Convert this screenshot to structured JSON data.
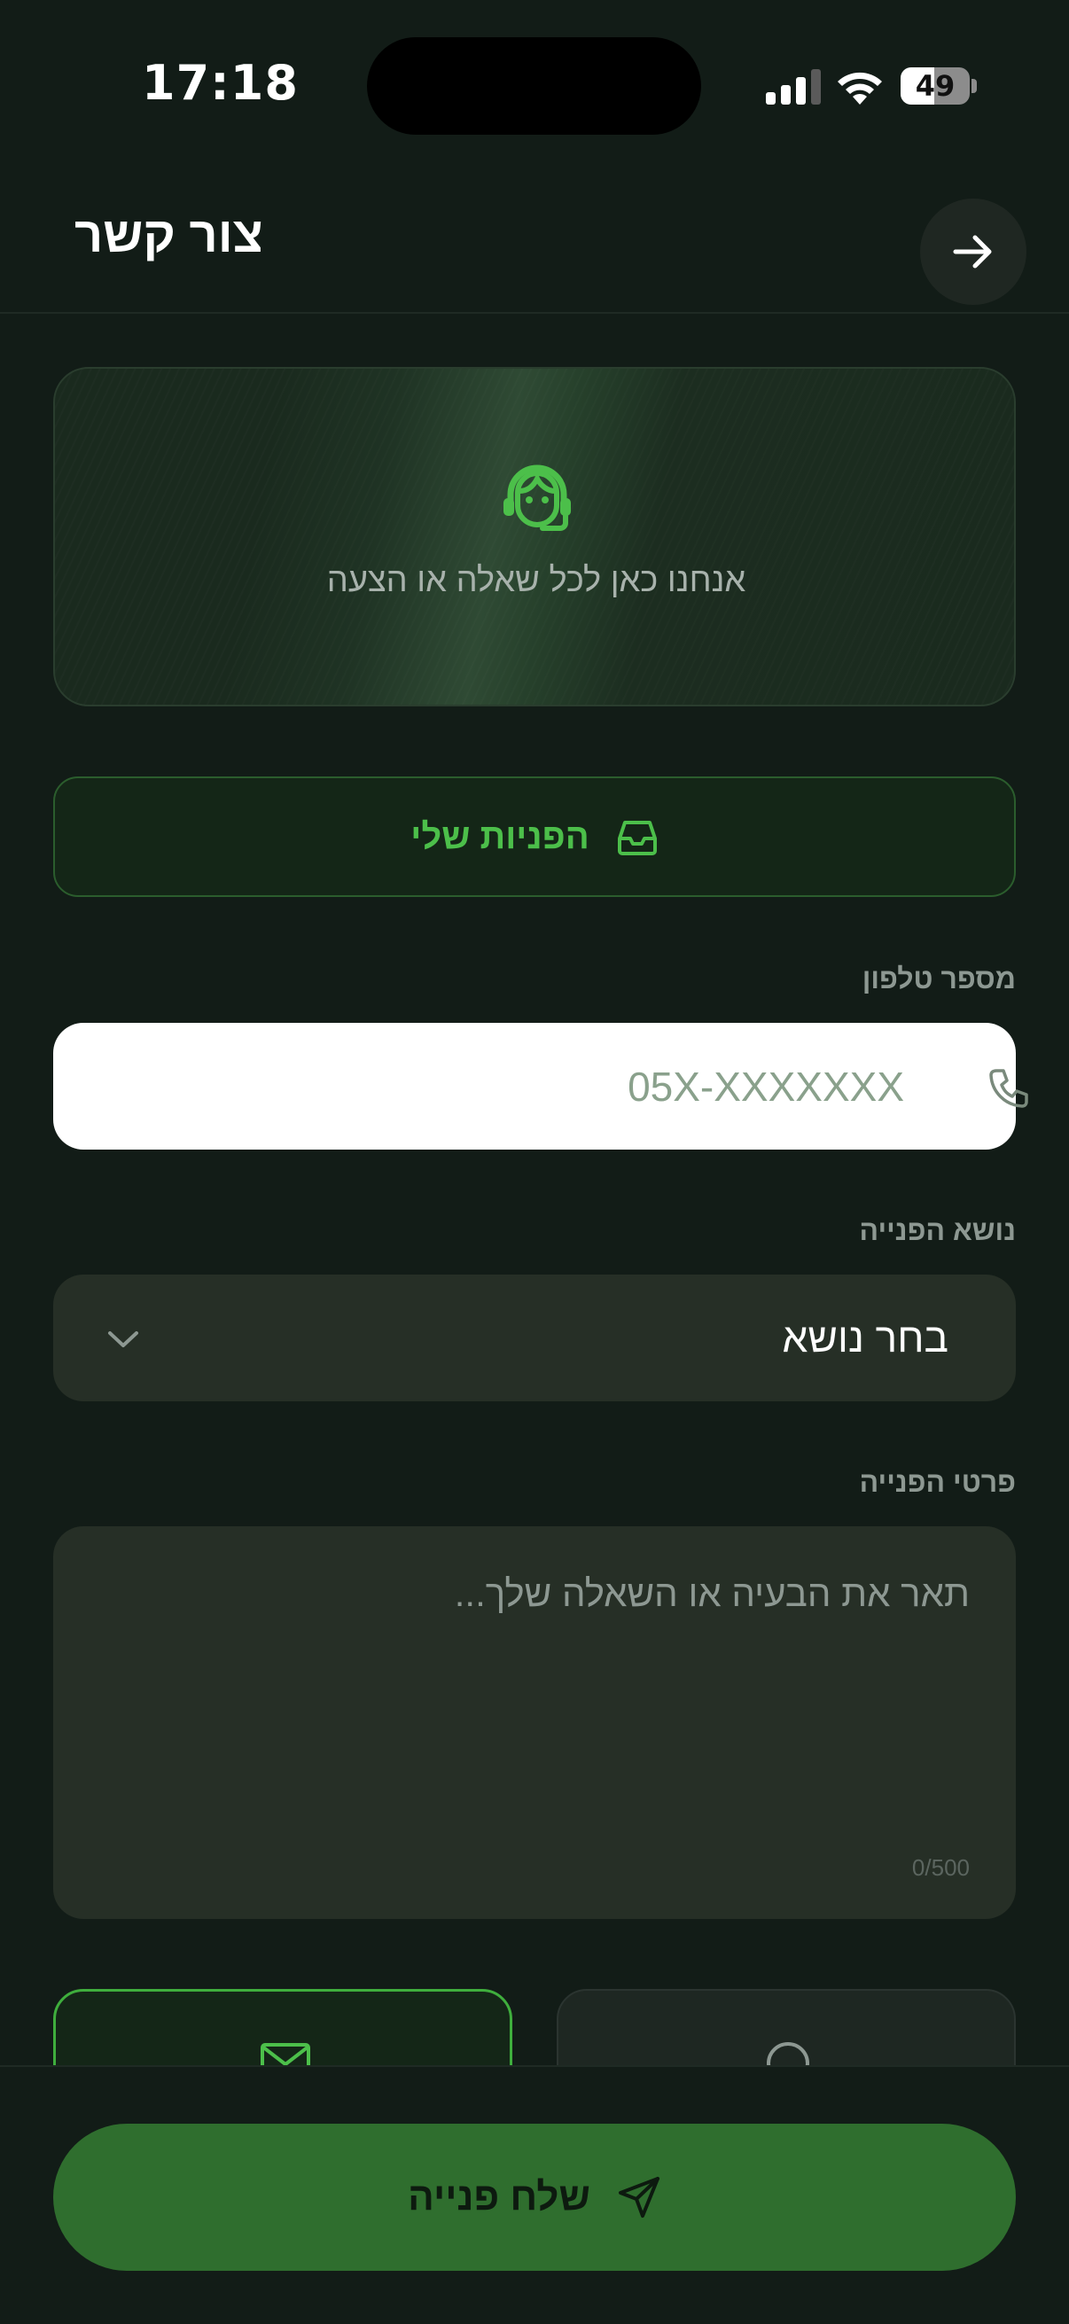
{
  "status_bar": {
    "time": "17:18",
    "battery_level": "49",
    "battery_fraction": 0.49
  },
  "header": {
    "title": "צור קשר",
    "back_icon": "arrow-right-icon"
  },
  "hero": {
    "icon": "support-agent-icon",
    "text": "אנחנו כאן לכל שאלה או הצעה",
    "icon_color": "#4cbf4a"
  },
  "requests_button": {
    "label": "הפניות שלי",
    "icon": "inbox-icon"
  },
  "phone": {
    "label": "מספר טלפון",
    "placeholder": "05X-XXXXXXX",
    "value": "",
    "icon": "phone-icon"
  },
  "subject": {
    "label": "נושא הפנייה",
    "selected": "בחר נושא",
    "icon": "chevron-down-icon"
  },
  "details": {
    "label": "פרטי הפנייה",
    "placeholder": "תאר את הבעיה או השאלה שלך...",
    "value": "",
    "counter": "0/500"
  },
  "contact_methods": [
    {
      "icon": "mail-icon",
      "selected": true
    },
    {
      "icon": "chat-icon",
      "selected": false
    }
  ],
  "submit": {
    "label": "שלח פנייה",
    "icon": "send-icon"
  },
  "colors": {
    "background": "#121c17",
    "accent": "#4cbf4a",
    "submit_bg": "#2f6e2e",
    "field_bg": "#262f26"
  }
}
